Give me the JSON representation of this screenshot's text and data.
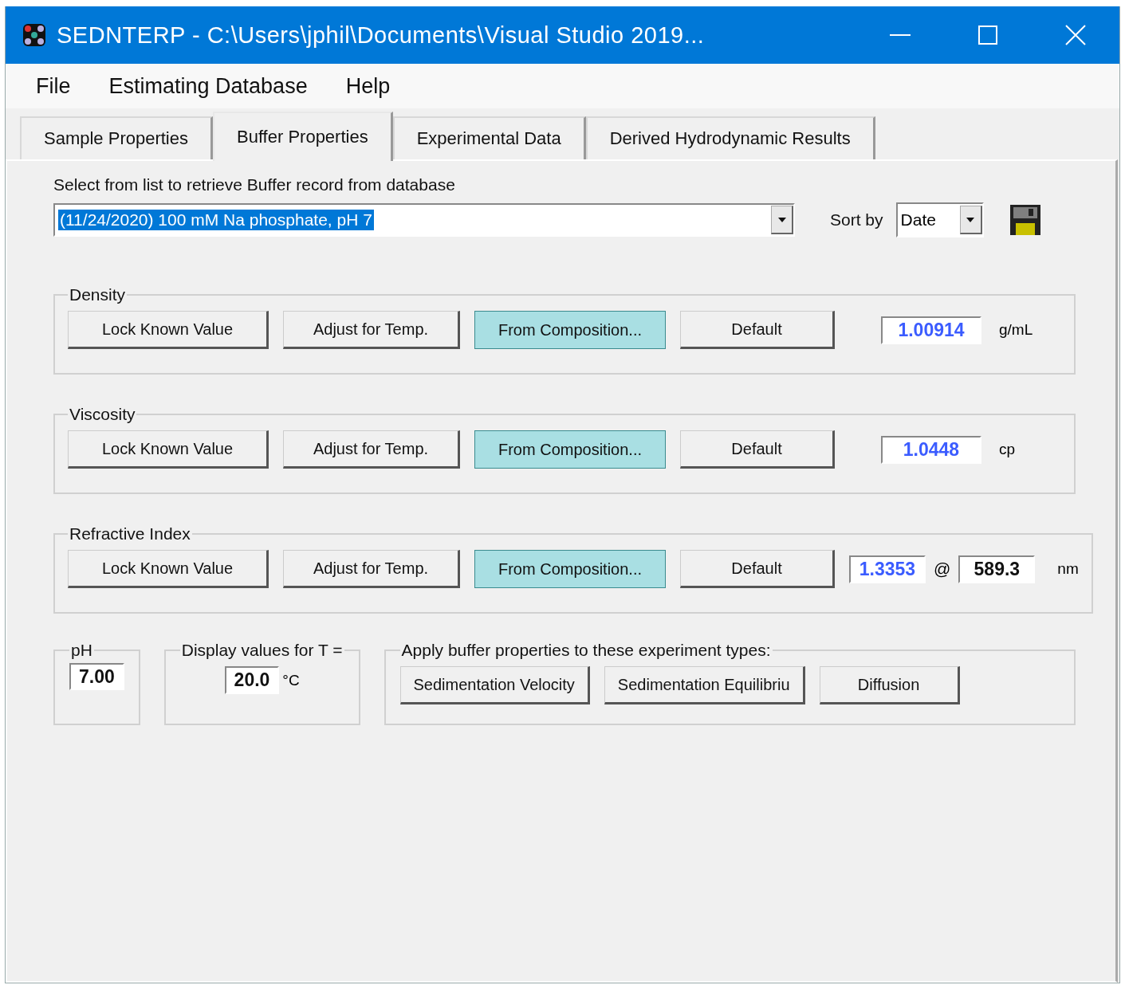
{
  "window": {
    "title": "SEDNTERP - C:\\Users\\jphil\\Documents\\Visual Studio 2019..."
  },
  "menu": [
    "File",
    "Estimating Database",
    "Help"
  ],
  "tabs": [
    {
      "label": "Sample Properties",
      "selected": false
    },
    {
      "label": "Buffer Properties",
      "selected": true
    },
    {
      "label": "Experimental Data",
      "selected": false
    },
    {
      "label": "Derived Hydrodynamic Results",
      "selected": false
    }
  ],
  "record_select": {
    "label": "Select from list to retrieve Buffer record from database",
    "value": "(11/24/2020) 100 mM Na phosphate, pH 7"
  },
  "sort": {
    "label": "Sort by",
    "value": "Date"
  },
  "properties": [
    {
      "title": "Density",
      "buttons": [
        {
          "label": "Lock Known Value",
          "selected": false
        },
        {
          "label": "Adjust for Temp.",
          "selected": false
        },
        {
          "label": "From Composition...",
          "selected": true
        },
        {
          "label": "Default",
          "selected": false
        }
      ],
      "value": "1.00914",
      "unit": "g/mL"
    },
    {
      "title": "Viscosity",
      "buttons": [
        {
          "label": "Lock Known Value",
          "selected": false
        },
        {
          "label": "Adjust for Temp.",
          "selected": false
        },
        {
          "label": "From Composition...",
          "selected": true
        },
        {
          "label": "Default",
          "selected": false
        }
      ],
      "value": "1.0448",
      "unit": "cp"
    },
    {
      "title": "Refractive Index",
      "buttons": [
        {
          "label": "Lock Known Value",
          "selected": false
        },
        {
          "label": "Adjust for Temp.",
          "selected": false
        },
        {
          "label": "From Composition...",
          "selected": true
        },
        {
          "label": "Default",
          "selected": false
        }
      ],
      "value": "1.3353",
      "at": "@",
      "wavelength": "589.3",
      "unit": "nm"
    }
  ],
  "ph": {
    "title": "pH",
    "value": "7.00"
  },
  "temperature": {
    "title": "Display values for T =",
    "value": "20.0",
    "unit": "°C"
  },
  "apply": {
    "title": "Apply buffer properties to these experiment types:",
    "buttons": [
      "Sedimentation Velocity",
      "Sedimentation Equilibriu",
      "Diffusion"
    ]
  }
}
